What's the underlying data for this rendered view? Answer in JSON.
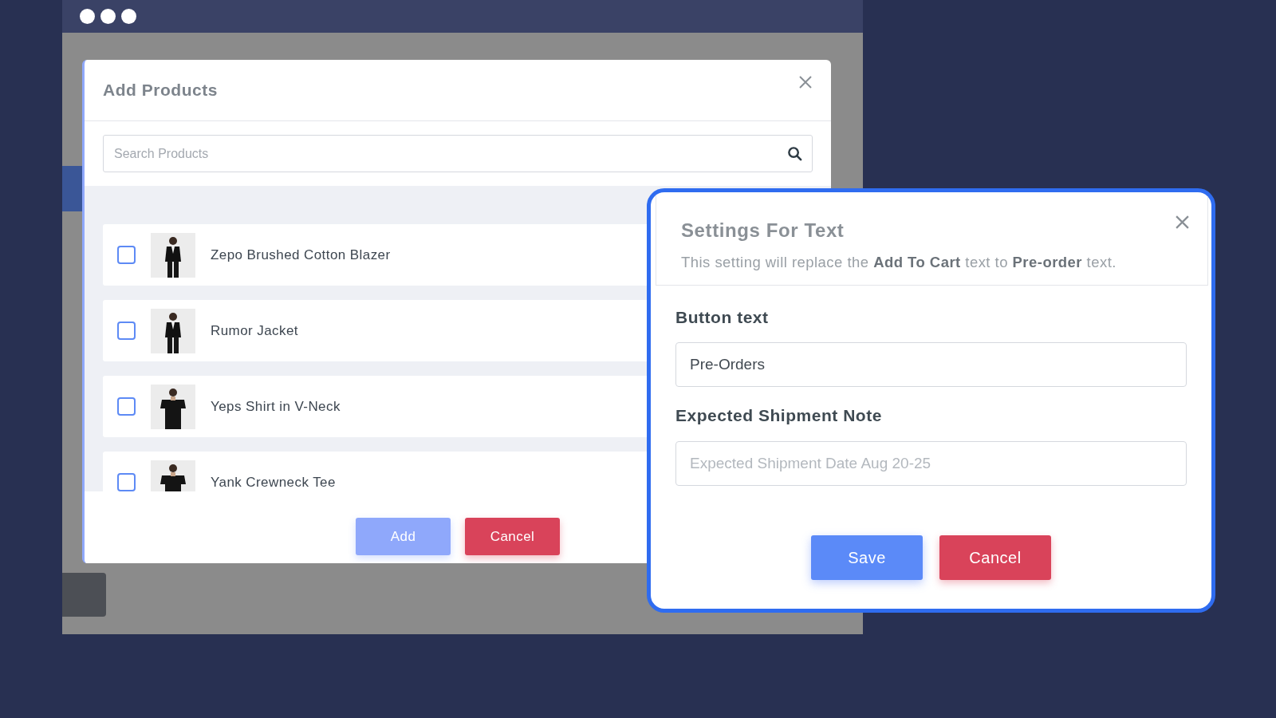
{
  "add_products": {
    "title": "Add Products",
    "search": {
      "placeholder": "Search Products"
    },
    "products": [
      {
        "name": "Zepo Brushed Cotton Blazer",
        "checked": false,
        "kind": "blazer"
      },
      {
        "name": "Rumor Jacket",
        "checked": false,
        "kind": "blazer"
      },
      {
        "name": "Yeps Shirt in V-Neck",
        "checked": false,
        "kind": "tee"
      },
      {
        "name": "Yank Crewneck Tee",
        "checked": false,
        "kind": "tee"
      }
    ],
    "buttons": [
      {
        "label": "Add",
        "kind": "primary",
        "disabled": true
      },
      {
        "label": "Cancel",
        "kind": "danger",
        "disabled": false
      }
    ]
  },
  "settings": {
    "title": "Settings For Text",
    "description": "This setting will replace the **Add To Cart** text to **Pre-order** text.",
    "fields": [
      {
        "label": "Button text",
        "value": "Pre-Orders"
      },
      {
        "label": "Expected Shipment Note",
        "placeholder": "Expected Shipment Date Aug 20-25"
      }
    ],
    "buttons": [
      {
        "label": "Save",
        "kind": "primary",
        "disabled": false
      },
      {
        "label": "Cancel",
        "kind": "danger",
        "disabled": false
      }
    ]
  }
}
